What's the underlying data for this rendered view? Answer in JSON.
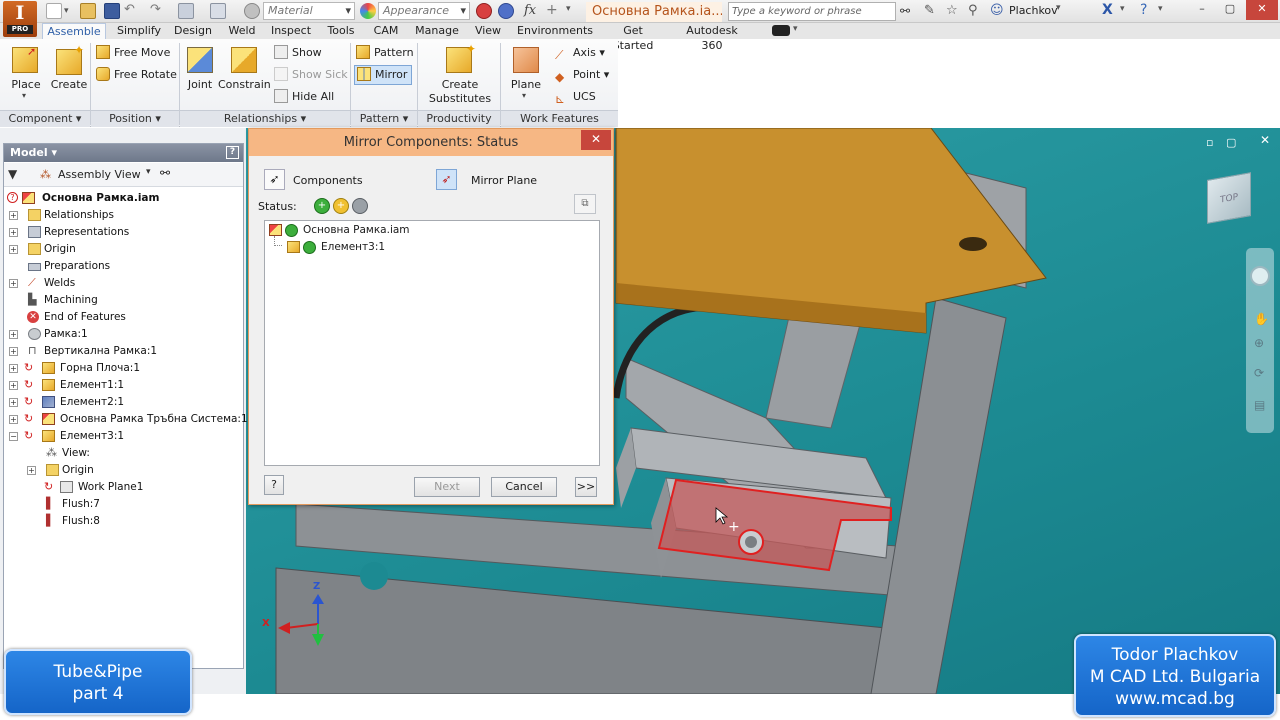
{
  "title_bar": {
    "material_placeholder": "Material",
    "appearance_placeholder": "Appearance",
    "fx_label": "fx",
    "document_title": "Основна Рамка.ia...",
    "search_placeholder": "Type a keyword or phrase",
    "user_name": "Plachkov",
    "window_buttons": [
      "–",
      "▢",
      "✕"
    ]
  },
  "menu_tabs": [
    "Assemble",
    "Simplify",
    "Design",
    "Weld",
    "Inspect",
    "Tools",
    "CAM",
    "Manage",
    "View",
    "Environments",
    "Get Started",
    "Autodesk 360"
  ],
  "ribbon": {
    "component": {
      "place": "Place",
      "create": "Create",
      "label": "Component ▾"
    },
    "position": {
      "free_move": "Free Move",
      "free_rotate": "Free Rotate",
      "label": "Position ▾"
    },
    "relationships": {
      "joint": "Joint",
      "constrain": "Constrain",
      "show": "Show",
      "show_sick": "Show Sick",
      "hide_all": "Hide All",
      "label": "Relationships ▾"
    },
    "pattern": {
      "pattern": "Pattern",
      "mirror": "Mirror",
      "label": "Pattern ▾"
    },
    "productivity": {
      "create_substitutes_1": "Create",
      "create_substitutes_2": "Substitutes",
      "label": "Productivity"
    },
    "work_features": {
      "plane": "Plane",
      "axis": "Axis ▾",
      "point": "Point ▾",
      "ucs": "UCS",
      "label": "Work Features"
    }
  },
  "model_browser": {
    "header": "Model ▾",
    "view_select": "Assembly View",
    "help": "?",
    "tree": [
      {
        "label": "Основна Рамка.iam",
        "bold": true
      },
      {
        "label": "Relationships"
      },
      {
        "label": "Representations"
      },
      {
        "label": "Origin"
      },
      {
        "label": "Preparations"
      },
      {
        "label": "Welds"
      },
      {
        "label": "Machining"
      },
      {
        "label": "End of Features"
      },
      {
        "label": "Рамка:1"
      },
      {
        "label": "Вертикална Рамка:1"
      },
      {
        "label": "Горна Плоча:1"
      },
      {
        "label": "Елемент1:1"
      },
      {
        "label": "Елемент2:1"
      },
      {
        "label": "Основна Рамка Тръбна Система:1"
      },
      {
        "label": "Елемент3:1"
      },
      {
        "label": "View:"
      },
      {
        "label": "Origin"
      },
      {
        "label": "Work Plane1"
      },
      {
        "label": "Flush:7"
      },
      {
        "label": "Flush:8"
      }
    ]
  },
  "dialog": {
    "title": "Mirror Components: Status",
    "close": "✕",
    "components_label": "Components",
    "mirror_plane_label": "Mirror Plane",
    "status_label": "Status:",
    "list": [
      "Основна Рамка.iam",
      "Елемент3:1"
    ],
    "help": "?",
    "next": "Next",
    "cancel": "Cancel",
    "more": ">>"
  },
  "viewport": {
    "viewcube_label": "TOP",
    "axis_z": "Z",
    "axis_x": "X"
  },
  "badges": {
    "left_line1": "Tube&Pipe",
    "left_line2": "part 4",
    "right_line1": "Todor Plachkov",
    "right_line2": "M CAD Ltd. Bulgaria",
    "right_line3": "www.mcad.bg"
  },
  "colors": {
    "ribbon_active": "#3060a8",
    "dialog_title": "#f6b784",
    "viewport_bg": "#1f8f98",
    "badge_bg": "#1e6fd6",
    "highlight_red": "#e02020",
    "wood": "#c8902e"
  }
}
